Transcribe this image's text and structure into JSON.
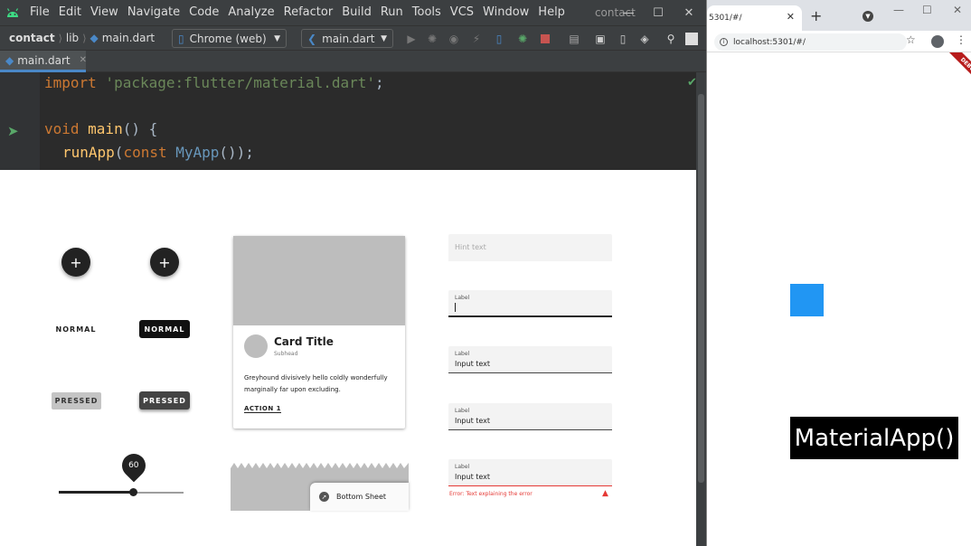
{
  "menubar": {
    "items": [
      "File",
      "Edit",
      "View",
      "Navigate",
      "Code",
      "Analyze",
      "Refactor",
      "Build",
      "Run",
      "Tools",
      "VCS",
      "Window",
      "Help"
    ],
    "project": "contact"
  },
  "navbar": {
    "crumbs": [
      "contact",
      "lib",
      "main.dart"
    ],
    "device": "Chrome (web)",
    "config": "main.dart"
  },
  "tab": {
    "label": "main.dart"
  },
  "code": {
    "line1": {
      "kw": "import",
      "str": " 'package:flutter/material.dart'",
      "rest": ";"
    },
    "line3": {
      "kw": "void",
      "fn": " main",
      "rest": "() {"
    },
    "line4": {
      "fn": "runApp",
      "rest1": "(",
      "kw": "const",
      "cls": " MyApp",
      "rest2": "());"
    }
  },
  "preview": {
    "fab_glyph": "+",
    "btn_normal": "NORMAL",
    "btn_pressed": "PRESSED",
    "slider": {
      "value": 60,
      "fraction": 0.6
    },
    "card": {
      "title": "Card Title",
      "subhead": "Subhead",
      "body": "Greyhound divisively hello coldly wonderfully marginally far upon excluding.",
      "action": "ACTION 1"
    },
    "bottom_sheet": "Bottom Sheet",
    "fields": {
      "hint": "Hint text",
      "label": "Label",
      "input": "Input text",
      "error": "Error: Text explaining the error"
    }
  },
  "browser": {
    "tab_title": "5301/#/",
    "url": "localhost:5301/#/",
    "debug": "DEBUG",
    "label": "MaterialApp()"
  },
  "colors": {
    "blue_box": "#2196f3",
    "accent": "#4a88c7",
    "error": "#e53935"
  }
}
